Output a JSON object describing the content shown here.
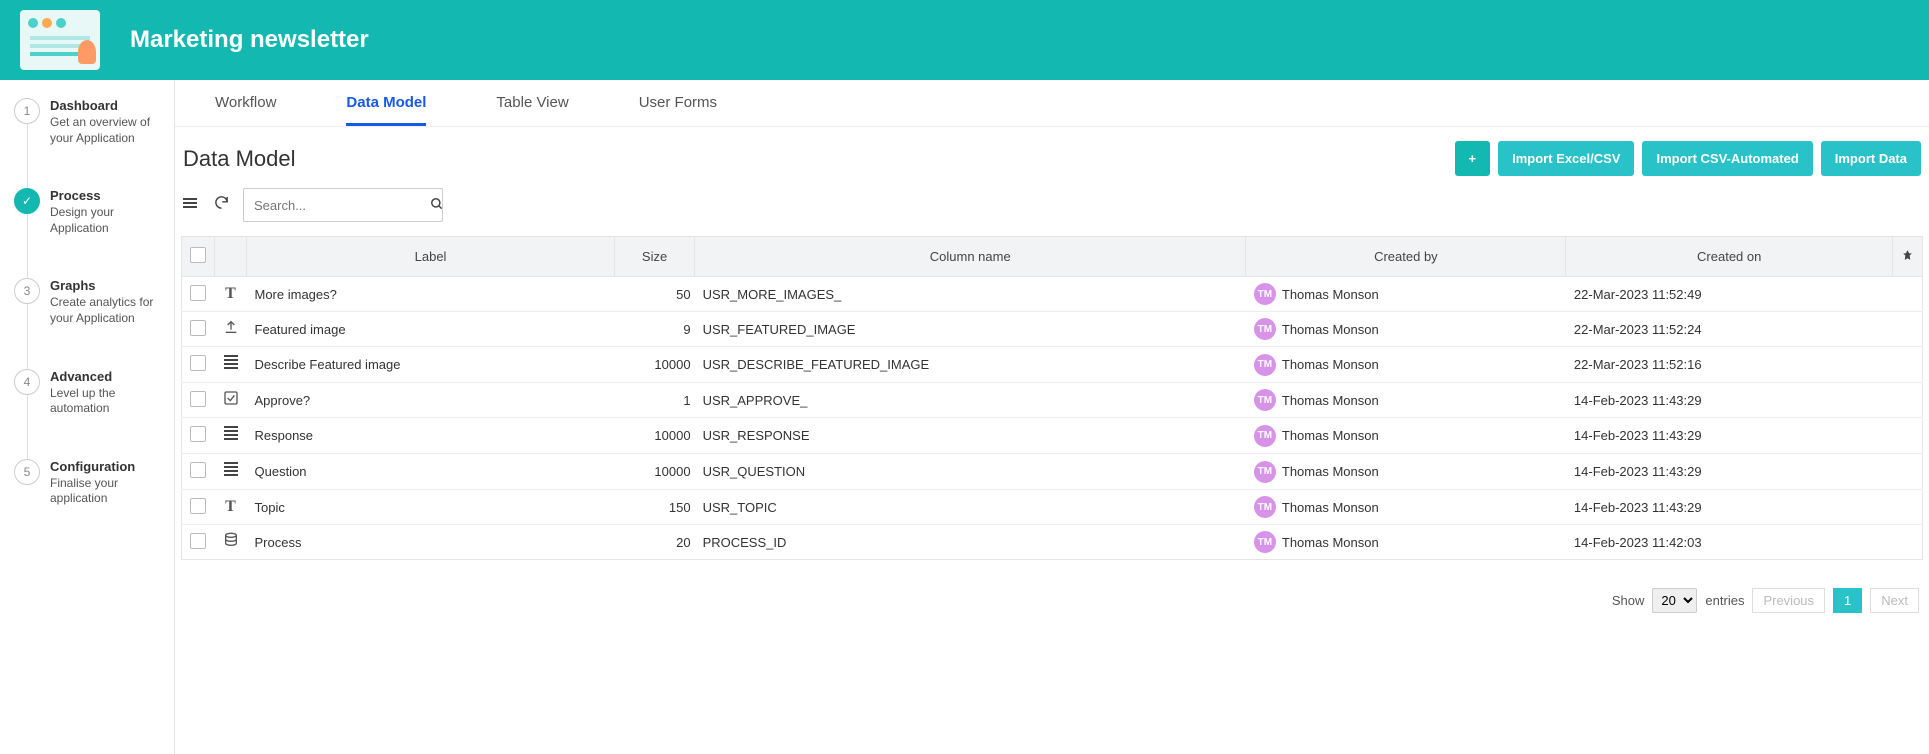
{
  "header": {
    "title": "Marketing newsletter"
  },
  "sidebar": {
    "steps": [
      {
        "num": "1",
        "title": "Dashboard",
        "desc": "Get an overview of your Application"
      },
      {
        "num": "✓",
        "title": "Process",
        "desc": "Design your Application",
        "active": true
      },
      {
        "num": "3",
        "title": "Graphs",
        "desc": "Create analytics for your Application"
      },
      {
        "num": "4",
        "title": "Advanced",
        "desc": "Level up the automation"
      },
      {
        "num": "5",
        "title": "Configuration",
        "desc": "Finalise your application"
      }
    ]
  },
  "tabs": [
    {
      "label": "Workflow",
      "active": false
    },
    {
      "label": "Data Model",
      "active": true
    },
    {
      "label": "Table View",
      "active": false
    },
    {
      "label": "User Forms",
      "active": false
    }
  ],
  "page": {
    "title": "Data Model"
  },
  "actions": {
    "add": "+",
    "import_excel": "Import Excel/CSV",
    "import_auto": "Import CSV-Automated",
    "import_data": "Import Data"
  },
  "search": {
    "placeholder": "Search..."
  },
  "table": {
    "headers": {
      "label": "Label",
      "size": "Size",
      "column": "Column name",
      "created_by": "Created by",
      "created_on": "Created on"
    },
    "rows": [
      {
        "icon": "T",
        "label": "More images?",
        "size": "50",
        "column": "USR_MORE_IMAGES_",
        "by_initials": "TM",
        "by": "Thomas Monson",
        "on": "22-Mar-2023 11:52:49"
      },
      {
        "icon": "upload",
        "label": "Featured image",
        "size": "9",
        "column": "USR_FEATURED_IMAGE",
        "by_initials": "TM",
        "by": "Thomas Monson",
        "on": "22-Mar-2023 11:52:24"
      },
      {
        "icon": "lines",
        "label": "Describe Featured image",
        "size": "10000",
        "column": "USR_DESCRIBE_FEATURED_IMAGE",
        "by_initials": "TM",
        "by": "Thomas Monson",
        "on": "22-Mar-2023 11:52:16"
      },
      {
        "icon": "check",
        "label": "Approve?",
        "size": "1",
        "column": "USR_APPROVE_",
        "by_initials": "TM",
        "by": "Thomas Monson",
        "on": "14-Feb-2023 11:43:29"
      },
      {
        "icon": "lines",
        "label": "Response",
        "size": "10000",
        "column": "USR_RESPONSE",
        "by_initials": "TM",
        "by": "Thomas Monson",
        "on": "14-Feb-2023 11:43:29"
      },
      {
        "icon": "lines",
        "label": "Question",
        "size": "10000",
        "column": "USR_QUESTION",
        "by_initials": "TM",
        "by": "Thomas Monson",
        "on": "14-Feb-2023 11:43:29"
      },
      {
        "icon": "T",
        "label": "Topic",
        "size": "150",
        "column": "USR_TOPIC",
        "by_initials": "TM",
        "by": "Thomas Monson",
        "on": "14-Feb-2023 11:43:29"
      },
      {
        "icon": "db",
        "label": "Process",
        "size": "20",
        "column": "PROCESS_ID",
        "by_initials": "TM",
        "by": "Thomas Monson",
        "on": "14-Feb-2023 11:42:03"
      }
    ]
  },
  "pagination": {
    "show_label": "Show",
    "entries_label": "entries",
    "page_size": "20",
    "prev": "Previous",
    "page": "1",
    "next": "Next"
  }
}
